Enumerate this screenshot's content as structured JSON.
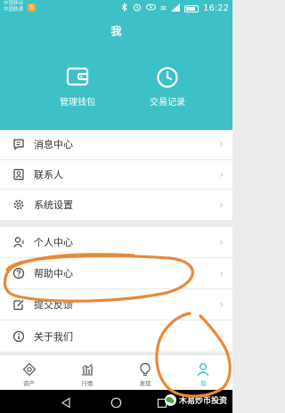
{
  "status_bar": {
    "carrier_1": "中国移动",
    "carrier_2": "中国联通",
    "sim_badge": "S",
    "wifi_indicator": "≋",
    "time": "16:22"
  },
  "header": {
    "title": "我",
    "quick_actions": [
      {
        "label": "管理钱包",
        "icon": "wallet-icon"
      },
      {
        "label": "交易记录",
        "icon": "clock-icon"
      }
    ]
  },
  "menu_group_1": [
    {
      "label": "消息中心",
      "icon": "message-icon"
    },
    {
      "label": "联系人",
      "icon": "contact-icon"
    },
    {
      "label": "系统设置",
      "icon": "gear-icon"
    }
  ],
  "menu_group_2": [
    {
      "label": "个人中心",
      "icon": "person-icon"
    },
    {
      "label": "帮助中心",
      "icon": "help-icon"
    },
    {
      "label": "提交反馈",
      "icon": "feedback-icon"
    },
    {
      "label": "关于我们",
      "icon": "info-icon"
    }
  ],
  "chevron": "›",
  "tabbar": {
    "tabs": [
      {
        "label": "资产",
        "icon": "asset-icon",
        "active": false
      },
      {
        "label": "行情",
        "icon": "market-icon",
        "active": false
      },
      {
        "label": "发现",
        "icon": "discover-icon",
        "active": false
      },
      {
        "label": "我",
        "icon": "me-icon",
        "active": true
      }
    ]
  },
  "watermark": {
    "text": "木易炒币投资"
  },
  "colors": {
    "accent": "#3ec1c6",
    "annotation": "#e8893a"
  }
}
